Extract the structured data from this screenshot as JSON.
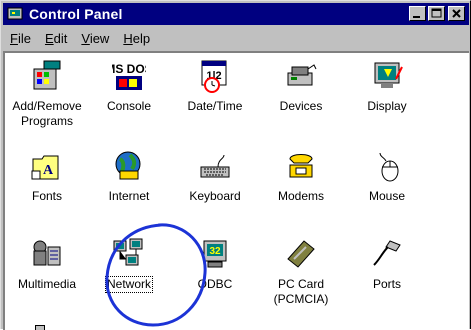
{
  "window": {
    "title": "Control Panel"
  },
  "menu": [
    {
      "key": "F",
      "rest": "ile"
    },
    {
      "key": "E",
      "rest": "dit"
    },
    {
      "key": "V",
      "rest": "iew"
    },
    {
      "key": "H",
      "rest": "elp"
    }
  ],
  "icons": {
    "add_remove": "Add/Remove\nPrograms",
    "console": "Console",
    "datetime": "Date/Time",
    "devices": "Devices",
    "display": "Display",
    "fonts": "Fonts",
    "internet": "Internet",
    "keyboard": "Keyboard",
    "modems": "Modems",
    "mouse": "Mouse",
    "multimedia": "Multimedia",
    "network": "Network",
    "odbc": "ODBC",
    "pccard": "PC Card\n(PCMCIA)",
    "ports": "Ports"
  },
  "icon_text": {
    "datetime_num": "1|2",
    "odbc_num": "32",
    "console_logo": "MS DOS"
  },
  "colors": {
    "titlebar": "#000080",
    "annotation": "#1c33d6"
  }
}
